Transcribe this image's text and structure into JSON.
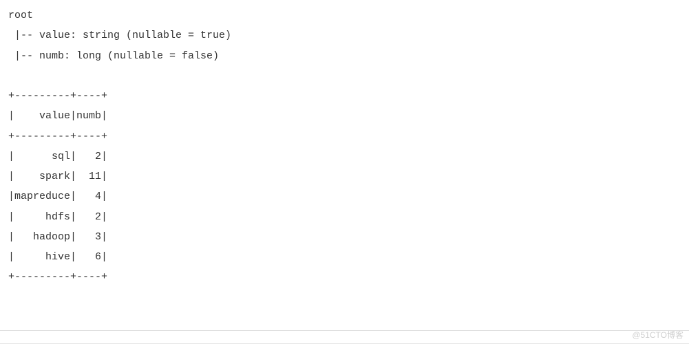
{
  "schema": {
    "root_label": "root",
    "fields": [
      {
        "line": " |-- value: string (nullable = true)"
      },
      {
        "line": " |-- numb: long (nullable = false)"
      }
    ]
  },
  "table": {
    "border_top": "+---------+----+",
    "header_line": "|    value|numb|",
    "border_mid": "+---------+----+",
    "rows": [
      "|      sql|   2|",
      "|    spark|  11|",
      "|mapreduce|   4|",
      "|     hdfs|   2|",
      "|   hadoop|   3|",
      "|     hive|   6|"
    ],
    "border_bot": "+---------+----+"
  },
  "chart_data": {
    "type": "table",
    "columns": [
      "value",
      "numb"
    ],
    "rows": [
      {
        "value": "sql",
        "numb": 2
      },
      {
        "value": "spark",
        "numb": 11
      },
      {
        "value": "mapreduce",
        "numb": 4
      },
      {
        "value": "hdfs",
        "numb": 2
      },
      {
        "value": "hadoop",
        "numb": 3
      },
      {
        "value": "hive",
        "numb": 6
      }
    ]
  },
  "watermark": "@51CTO博客"
}
